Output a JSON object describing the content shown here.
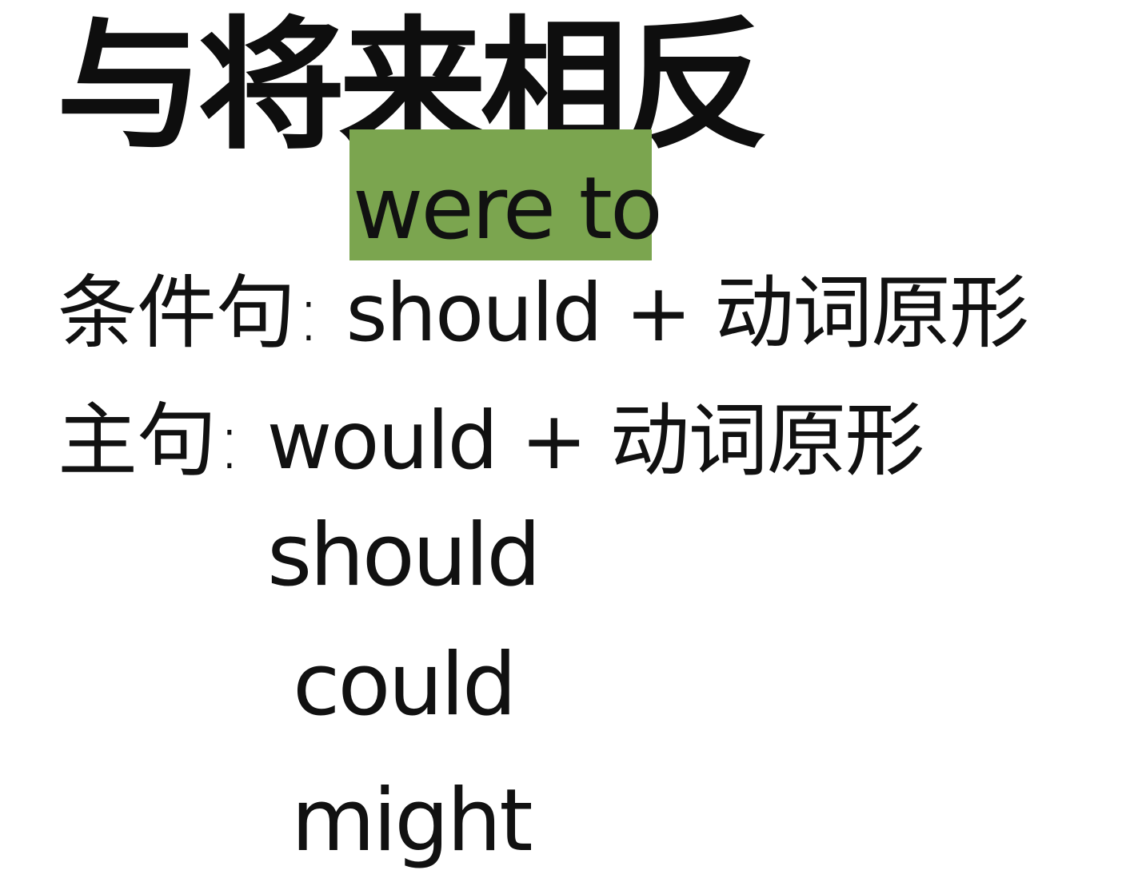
{
  "slide": {
    "title": "与将来相反",
    "highlight": {
      "text": "were to",
      "color": "#7ba54f"
    },
    "conditional_clause": {
      "label": "条件句:",
      "formula": "should + 动词原形"
    },
    "main_clause": {
      "label": "主句:",
      "formula": "would + 动词原形"
    },
    "alternatives": [
      "should",
      "could",
      "might"
    ]
  },
  "colors": {
    "text": "#111111",
    "background": "#ffffff",
    "highlight": "#7ba54f"
  }
}
